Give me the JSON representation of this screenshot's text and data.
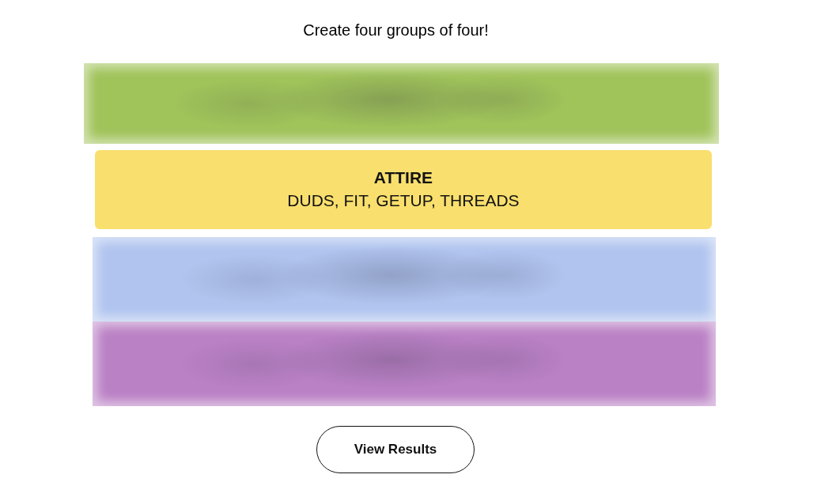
{
  "instructions": "Create four groups of four!",
  "groups": [
    {
      "kind": "hidden",
      "color": "#a0c35a"
    },
    {
      "kind": "solved",
      "color": "#f9df6d",
      "title": "ATTIRE",
      "words": "DUDS, FIT, GETUP, THREADS"
    },
    {
      "kind": "hidden",
      "color": "#b0c4ef"
    },
    {
      "kind": "hidden",
      "color": "#ba81c5"
    }
  ],
  "button": {
    "label": "View Results"
  }
}
